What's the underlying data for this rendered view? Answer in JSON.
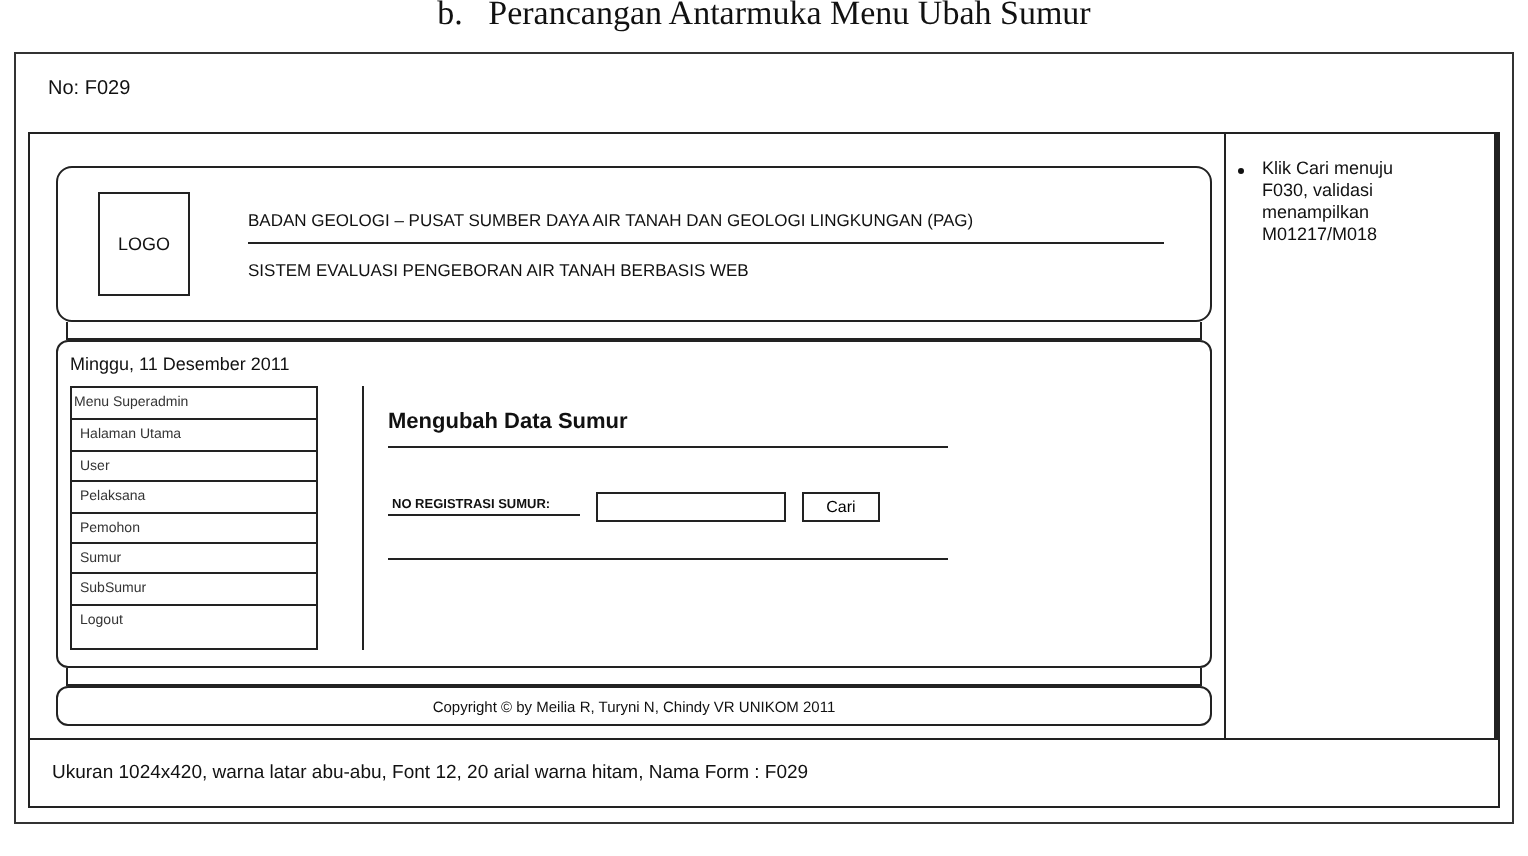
{
  "heading": "b.   Perancangan Antarmuka Menu Ubah Sumur",
  "form_no": "No: F029",
  "header": {
    "logo": "LOGO",
    "title": "BADAN GEOLOGI – PUSAT SUMBER DAYA AIR TANAH DAN GEOLOGI LINGKUNGAN (PAG)",
    "subtitle": "SISTEM EVALUASI PENGEBORAN AIR TANAH BERBASIS WEB"
  },
  "date": "Minggu, 11 Desember 2011",
  "menu": [
    "Menu Superadmin",
    "Halaman Utama",
    "User",
    "Pelaksana",
    "Pemohon",
    "Sumur",
    "SubSumur",
    "Logout"
  ],
  "content": {
    "title": "Mengubah Data Sumur",
    "field_label": "NO REGISTRASI SUMUR:",
    "button": "Cari"
  },
  "footer": "Copyright © by Meilia R, Turyni N, Chindy VR UNIKOM 2011",
  "notes": [
    "Klik Cari menuju F030, validasi menampilkan M01217/M018"
  ],
  "caption": "Ukuran 1024x420, warna latar abu-abu, Font 12, 20 arial warna hitam, Nama Form : F029"
}
